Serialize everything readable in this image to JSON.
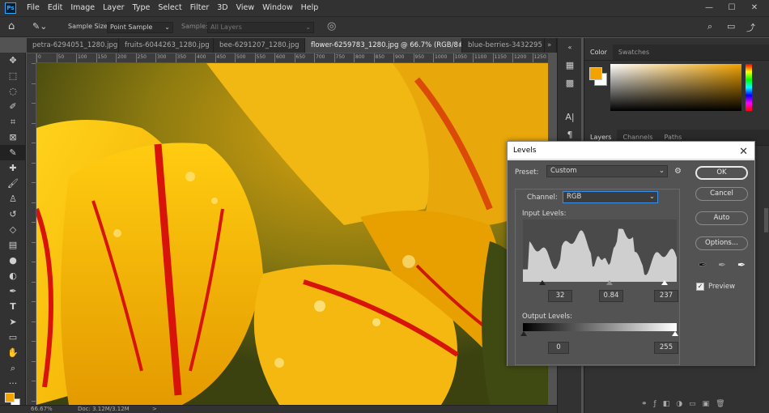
{
  "app": {
    "logo": "Ps"
  },
  "menu": [
    "File",
    "Edit",
    "Image",
    "Layer",
    "Type",
    "Select",
    "Filter",
    "3D",
    "View",
    "Window",
    "Help"
  ],
  "window_controls": {
    "minimize": "—",
    "maximize": "☐",
    "close": "✕"
  },
  "options": {
    "sample_size_label": "Sample Size:",
    "sample_size_value": "Point Sample",
    "sample_label": "Sample:",
    "sample_value": "All Layers"
  },
  "tabs": [
    {
      "label": "petra-6294051_1280.jpg"
    },
    {
      "label": "fruits-6044263_1280.jpg"
    },
    {
      "label": "bee-6291207_1280.jpg"
    },
    {
      "label": "flower-6259783_1280.jpg @ 66.7% (RGB/8#)"
    },
    {
      "label": "blue-berries-3432295"
    }
  ],
  "tab_overflow": "»",
  "ruler_ticks": [
    "0",
    "50",
    "100",
    "150",
    "200",
    "250",
    "300",
    "350",
    "400",
    "450",
    "500",
    "550",
    "600",
    "650",
    "700",
    "750",
    "800",
    "850",
    "900",
    "950",
    "1000",
    "1050",
    "1100",
    "1150",
    "1200",
    "1250"
  ],
  "status": {
    "zoom": "66.67%",
    "doc": "Doc: 3.12M/3.12M",
    "arrow": ">"
  },
  "panels": {
    "color_tabs": [
      "Color",
      "Swatches"
    ],
    "layers_tabs": [
      "Layers",
      "Channels",
      "Paths"
    ],
    "foreground_color": "#f2a300"
  },
  "levels": {
    "title": "Levels",
    "preset_label": "Preset:",
    "preset_value": "Custom",
    "channel_label": "Channel:",
    "channel_value": "RGB",
    "input_label": "Input Levels:",
    "output_label": "Output Levels:",
    "input_black": "32",
    "input_gamma": "0.84",
    "input_white": "237",
    "output_black": "0",
    "output_white": "255",
    "buttons": {
      "ok": "OK",
      "cancel": "Cancel",
      "auto": "Auto",
      "options": "Options..."
    },
    "preview_label": "Preview",
    "preview_checked": true
  }
}
